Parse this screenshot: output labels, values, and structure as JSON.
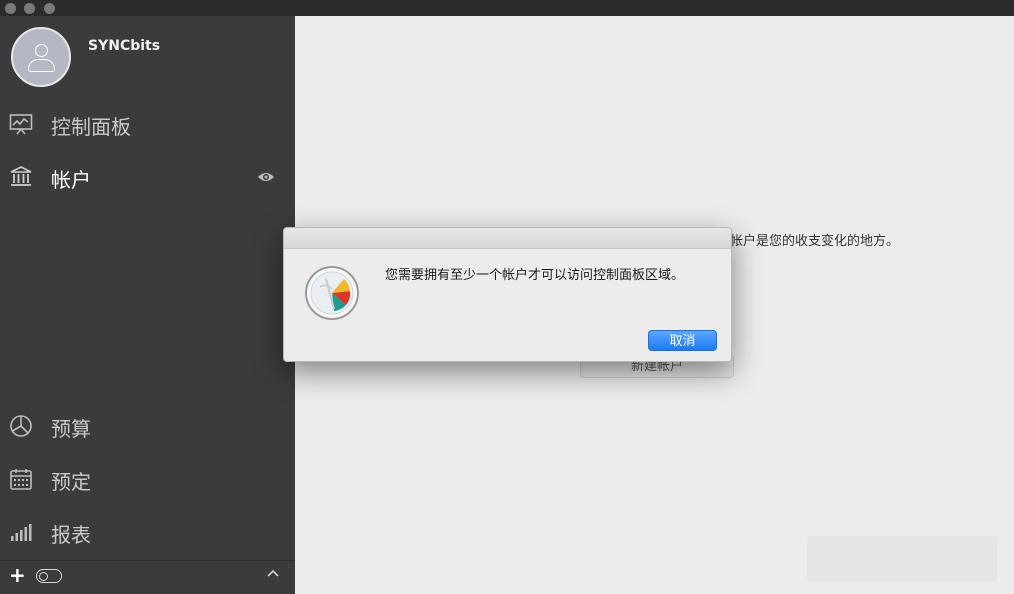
{
  "window": {
    "traffic_lights": [
      "close",
      "minimize",
      "zoom"
    ]
  },
  "sidebar": {
    "user": {
      "name": "SYNCbits",
      "avatar_icon": "user-avatar-icon"
    },
    "top_items": [
      {
        "label": "控制面板",
        "icon": "dashboard-chart-icon"
      },
      {
        "label": "帐户",
        "icon": "bank-icon",
        "trailing_icon": "eye-icon"
      }
    ],
    "bottom_items": [
      {
        "label": "预算",
        "icon": "pie-chart-icon"
      },
      {
        "label": "预定",
        "icon": "calendar-icon"
      },
      {
        "label": "报表",
        "icon": "bar-chart-icon"
      }
    ],
    "footer": {
      "add_label": "+",
      "icons": [
        "toggle-icon",
        "chevron-up-icon"
      ]
    }
  },
  "main": {
    "background_text": "帐户是您的收支变化的地方。",
    "background_button": "新建帐户"
  },
  "dialog": {
    "message": "您需要拥有至少一个帐户才可以访问控制面板区域。",
    "button_label": "取消",
    "icon": "app-logo-icon",
    "accent_color": "#1b7bf4"
  }
}
